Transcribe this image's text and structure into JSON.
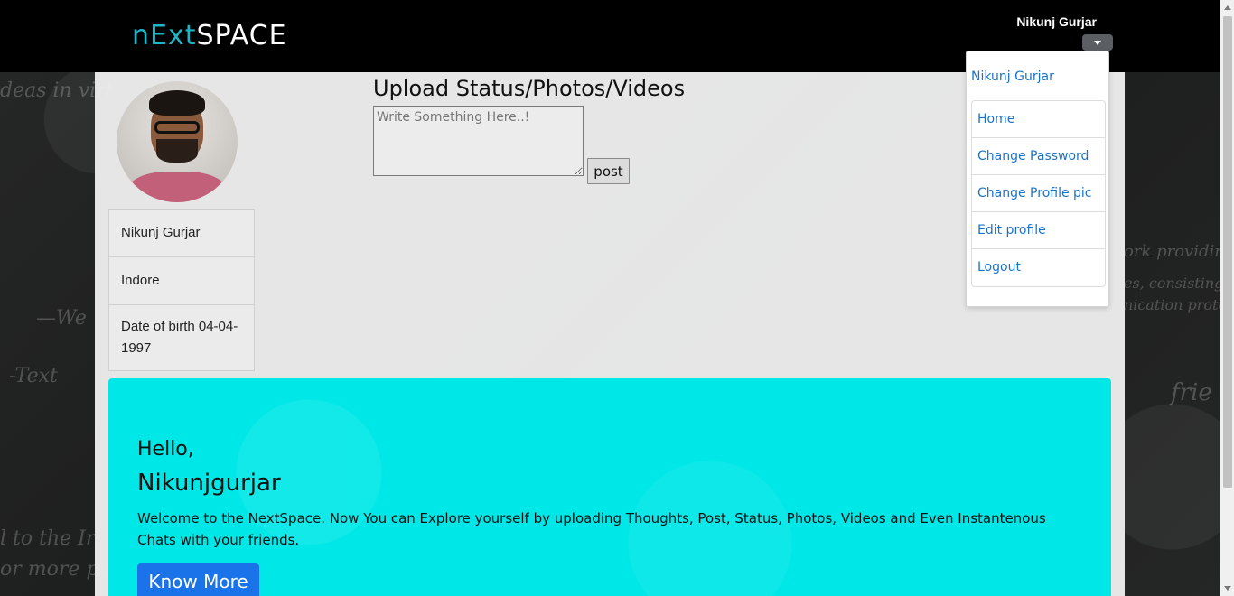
{
  "header": {
    "logo_prefix": "nExt",
    "logo_suffix": "SPACE",
    "user_name": "Nikunj Gurjar"
  },
  "profile": {
    "name": "Nikunj Gurjar",
    "city": "Indore",
    "dob": "Date of birth 04-04-1997"
  },
  "upload": {
    "title": "Upload Status/Photos/Videos",
    "placeholder": "Write Something Here..!",
    "post_label": "post"
  },
  "hero": {
    "hello": "Hello,",
    "name": "Nikunjgurjar",
    "text": "Welcome to the NextSpace. Now You can Explore yourself by uploading Thoughts, Post, Status, Photos, Videos and Even Instantenous Chats with your friends.",
    "button_label": "Know More"
  },
  "dropdown": {
    "header": "Nikunj Gurjar",
    "items": [
      "Home",
      "Change Password",
      "Change Profile pic",
      "Edit profile",
      "Logout"
    ]
  },
  "colors": {
    "navbar": "#000000",
    "hero_bg": "#00e7e7",
    "link": "#1a73c9",
    "button_primary": "#1a73e8"
  }
}
